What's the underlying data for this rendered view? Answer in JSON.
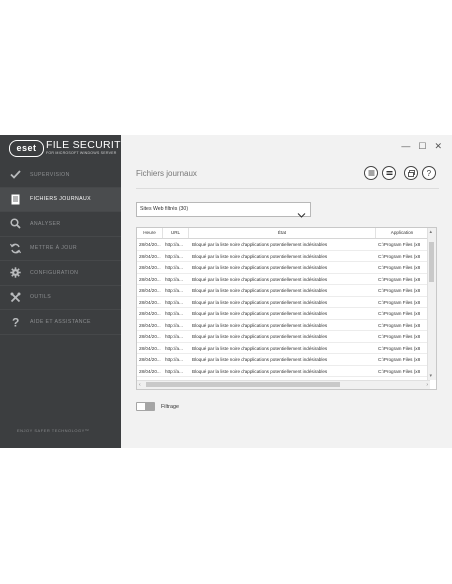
{
  "app": {
    "logo_text": "eset",
    "product_name": "FILE SECURITY",
    "product_subtitle": "FOR MICROSOFT WINDOWS SERVER",
    "tagline": "ENJOY SAFER TECHNOLOGY™"
  },
  "window_controls": {
    "minimize": "—",
    "maximize": "☐",
    "close": "✕"
  },
  "sidebar": {
    "items": [
      {
        "label": "SUPERVISION",
        "icon": "check-icon",
        "active": false
      },
      {
        "label": "FICHIERS JOURNAUX",
        "icon": "log-file-icon",
        "active": true
      },
      {
        "label": "ANALYSER",
        "icon": "search-icon",
        "active": false
      },
      {
        "label": "METTRE À JOUR",
        "icon": "refresh-icon",
        "active": false
      },
      {
        "label": "CONFIGURATION",
        "icon": "gear-icon",
        "active": false
      },
      {
        "label": "OUTILS",
        "icon": "tools-icon",
        "active": false
      },
      {
        "label": "AIDE ET ASSISTANCE",
        "icon": "help-icon",
        "active": false
      }
    ]
  },
  "main": {
    "title": "Fichiers journaux",
    "log_selector": {
      "selected": "Sites Web filtrés (30)"
    },
    "table": {
      "columns": [
        "Heure",
        "URL",
        "État",
        "Application"
      ],
      "rows": [
        {
          "time": "28/04/20...",
          "url": "http://a...",
          "state": "Bloqué par la liste noire d'applications potentiellement indésirables",
          "app": "C:\\Program Files (x8"
        },
        {
          "time": "28/04/20...",
          "url": "http://a...",
          "state": "Bloqué par la liste noire d'applications potentiellement indésirables",
          "app": "C:\\Program Files (x8"
        },
        {
          "time": "28/04/20...",
          "url": "http://a...",
          "state": "Bloqué par la liste noire d'applications potentiellement indésirables",
          "app": "C:\\Program Files (x8"
        },
        {
          "time": "28/04/20...",
          "url": "http://a...",
          "state": "Bloqué par la liste noire d'applications potentiellement indésirables",
          "app": "C:\\Program Files (x8"
        },
        {
          "time": "28/04/20...",
          "url": "http://a...",
          "state": "Bloqué par la liste noire d'applications potentiellement indésirables",
          "app": "C:\\Program Files (x8"
        },
        {
          "time": "28/04/20...",
          "url": "http://a...",
          "state": "Bloqué par la liste noire d'applications potentiellement indésirables",
          "app": "C:\\Program Files (x8"
        },
        {
          "time": "28/04/20...",
          "url": "http://a...",
          "state": "Bloqué par la liste noire d'applications potentiellement indésirables",
          "app": "C:\\Program Files (x8"
        },
        {
          "time": "28/04/20...",
          "url": "http://a...",
          "state": "Bloqué par la liste noire d'applications potentiellement indésirables",
          "app": "C:\\Program Files (x8"
        },
        {
          "time": "28/04/20...",
          "url": "http://a...",
          "state": "Bloqué par la liste noire d'applications potentiellement indésirables",
          "app": "C:\\Program Files (x8"
        },
        {
          "time": "28/04/20...",
          "url": "http://a...",
          "state": "Bloqué par la liste noire d'applications potentiellement indésirables",
          "app": "C:\\Program Files (x8"
        },
        {
          "time": "28/04/20...",
          "url": "http://a...",
          "state": "Bloqué par la liste noire d'applications potentiellement indésirables",
          "app": "C:\\Program Files (x8"
        },
        {
          "time": "28/04/20...",
          "url": "http://a...",
          "state": "Bloqué par la liste noire d'applications potentiellement indésirables",
          "app": "C:\\Program Files (x8"
        }
      ]
    },
    "filter": {
      "label": "Filtrage",
      "enabled": false
    }
  },
  "colors": {
    "sidebar_bg": "#3c3e40",
    "active_item": "#4a4c4e",
    "content_bg": "#f2f2f2"
  }
}
